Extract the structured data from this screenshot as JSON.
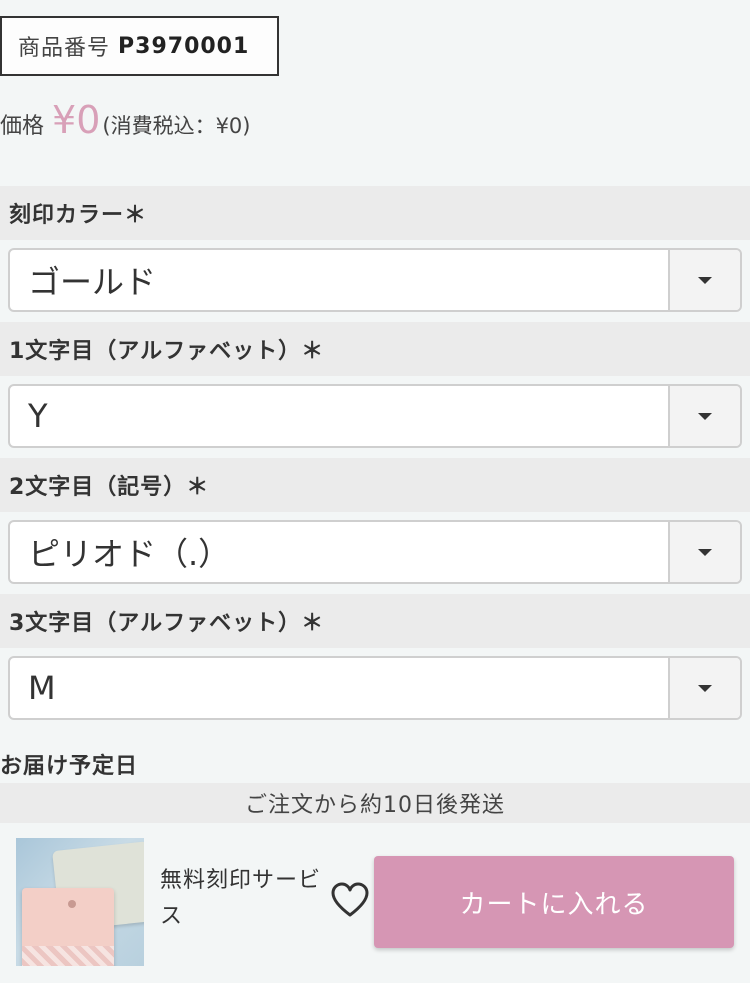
{
  "product": {
    "code_label": "商品番号",
    "code_value": "P3970001"
  },
  "price": {
    "label": "価格",
    "value": "¥0",
    "tax_note": "(消費税込：¥0)",
    "accent_color": "#d8a0b8"
  },
  "options": [
    {
      "label": "刻印カラー＊",
      "selected": "ゴールド"
    },
    {
      "label": "1文字目（アルファベット）＊",
      "selected": "Y"
    },
    {
      "label": "2文字目（記号）＊",
      "selected": "ピリオド（.）"
    },
    {
      "label": "3文字目（アルファベット）＊",
      "selected": "M"
    }
  ],
  "delivery": {
    "title": "お届け予定日",
    "note": "ご注文から約10日後発送"
  },
  "footer": {
    "service_text": "無料刻印サービス",
    "favorite_icon": "heart-icon",
    "cart_button_label": "カートに入れる",
    "cart_button_color": "#d696b4"
  }
}
